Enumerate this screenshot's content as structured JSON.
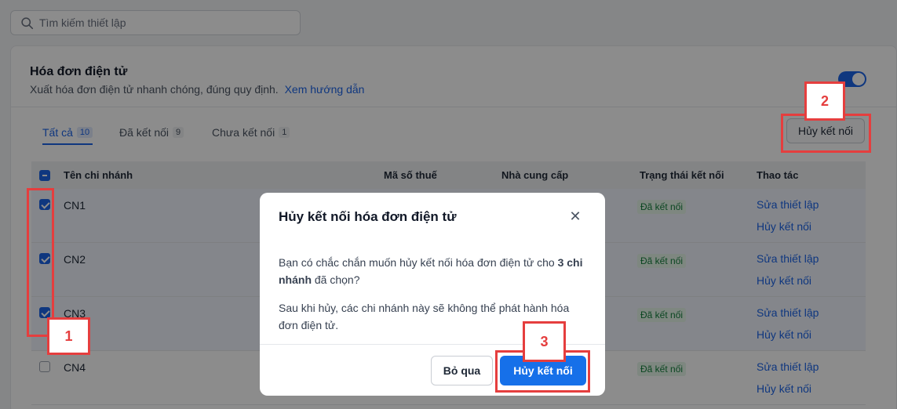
{
  "search": {
    "placeholder": "Tìm kiếm thiết lập"
  },
  "section": {
    "title": "Hóa đơn điện tử",
    "description": "Xuất hóa đơn điện tử nhanh chóng, đúng quy định.",
    "guide_link": "Xem hướng dẫn",
    "enabled": true
  },
  "tabs": [
    {
      "label": "Tất cả",
      "count": "10",
      "active": true
    },
    {
      "label": "Đã kết nối",
      "count": "9",
      "active": false
    },
    {
      "label": "Chưa kết nối",
      "count": "1",
      "active": false
    }
  ],
  "bulk_disconnect_label": "Hủy kết nối",
  "table": {
    "columns": [
      "Tên chi nhánh",
      "Mã số thuế",
      "Nhà cung cấp",
      "Trạng thái kết nối",
      "Thao tác"
    ],
    "rows": [
      {
        "name": "CN1",
        "status": "Đã kết nối",
        "selected": true,
        "actions": [
          "Sửa thiết lập",
          "Hủy kết nối"
        ]
      },
      {
        "name": "CN2",
        "status": "Đã kết nối",
        "selected": true,
        "actions": [
          "Sửa thiết lập",
          "Hủy kết nối"
        ]
      },
      {
        "name": "CN3",
        "status": "Đã kết nối",
        "selected": true,
        "actions": [
          "Sửa thiết lập",
          "Hủy kết nối"
        ]
      },
      {
        "name": "CN4",
        "status": "Đã kết nối",
        "selected": false,
        "actions": [
          "Sửa thiết lập",
          "Hủy kết nối"
        ]
      }
    ]
  },
  "modal": {
    "title": "Hủy kết nối hóa đơn điện tử",
    "body_1_pre": "Bạn có chắc chắn muốn hủy kết nối hóa đơn điện tử cho ",
    "body_1_bold": "3 chi nhánh",
    "body_1_post": " đã chọn?",
    "body_2": "Sau khi hủy, các chi nhánh này sẽ không thể phát hành hóa đơn điện tử.",
    "cancel_label": "Bỏ qua",
    "confirm_label": "Hủy kết nối"
  },
  "annotations": {
    "step_1": "1",
    "step_2": "2",
    "step_3": "3"
  },
  "colors": {
    "accent": "#1d64e8",
    "highlight": "#e53e3e",
    "connected": "#15803d"
  }
}
